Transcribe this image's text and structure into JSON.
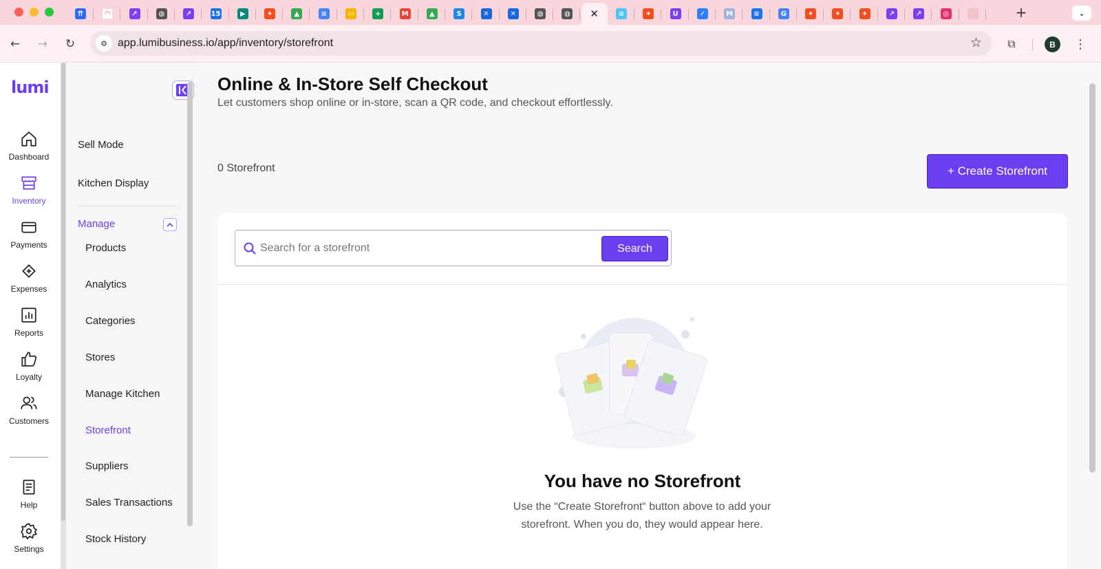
{
  "browser": {
    "tabs": [
      {
        "icon": "jira-icon",
        "color": "#2f6cf6",
        "glyph": "⇈"
      },
      {
        "icon": "monday-icon",
        "color": "#ffffff",
        "glyph": "◠"
      },
      {
        "icon": "clickup-icon",
        "color": "#7b3ff2",
        "glyph": "↗"
      },
      {
        "icon": "globe-icon",
        "color": "#555555",
        "glyph": "◍"
      },
      {
        "icon": "clickup-icon",
        "color": "#7b3ff2",
        "glyph": "↗"
      },
      {
        "icon": "calendar-icon",
        "color": "#1a73e8",
        "glyph": "15"
      },
      {
        "icon": "meet-icon",
        "color": "#00897b",
        "glyph": "▶"
      },
      {
        "icon": "figma-icon",
        "color": "#f24e1e",
        "glyph": "✦"
      },
      {
        "icon": "drive-icon",
        "color": "#34a853",
        "glyph": "▲"
      },
      {
        "icon": "docs-icon",
        "color": "#4285f4",
        "glyph": "≡"
      },
      {
        "icon": "slides-icon",
        "color": "#f4b400",
        "glyph": "▭"
      },
      {
        "icon": "sheets-icon",
        "color": "#0f9d58",
        "glyph": "+"
      },
      {
        "icon": "gmail-icon",
        "color": "#ea4335",
        "glyph": "M"
      },
      {
        "icon": "drive-icon",
        "color": "#34a853",
        "glyph": "▲"
      },
      {
        "icon": "skype-icon",
        "color": "#1e88e5",
        "glyph": "S"
      },
      {
        "icon": "confluence-icon",
        "color": "#1868db",
        "glyph": "✕"
      },
      {
        "icon": "confluence-icon",
        "color": "#1868db",
        "glyph": "✕"
      },
      {
        "icon": "globe-icon",
        "color": "#555555",
        "glyph": "◍"
      },
      {
        "icon": "globe-icon",
        "color": "#555555",
        "glyph": "◍"
      },
      {
        "icon": "close-icon",
        "color": "#222222",
        "glyph": "✕",
        "active": true
      },
      {
        "icon": "docs-icon",
        "color": "#4fc3f7",
        "glyph": "≡"
      },
      {
        "icon": "figma-icon",
        "color": "#f24e1e",
        "glyph": "✦"
      },
      {
        "icon": "upwork-icon",
        "color": "#7b3ff2",
        "glyph": "U"
      },
      {
        "icon": "check-icon",
        "color": "#2d7ff9",
        "glyph": "✓"
      },
      {
        "icon": "miro-icon",
        "color": "#9fb4d8",
        "glyph": "M"
      },
      {
        "icon": "docs-icon",
        "color": "#1a73e8",
        "glyph": "≡"
      },
      {
        "icon": "google-icon",
        "color": "#4285f4",
        "glyph": "G"
      },
      {
        "icon": "figma-icon",
        "color": "#f24e1e",
        "glyph": "✦"
      },
      {
        "icon": "figma-icon",
        "color": "#f24e1e",
        "glyph": "✦"
      },
      {
        "icon": "figma-icon",
        "color": "#f24e1e",
        "glyph": "✦"
      },
      {
        "icon": "clickup-icon",
        "color": "#7b3ff2",
        "glyph": "↗"
      },
      {
        "icon": "clickup-icon",
        "color": "#7b3ff2",
        "glyph": "↗"
      },
      {
        "icon": "instagram-icon",
        "color": "#e1306c",
        "glyph": "◎"
      },
      {
        "icon": "blank-tab-icon",
        "color": "#f3c2cb",
        "glyph": ""
      }
    ],
    "url": "app.lumibusiness.io/app/inventory/storefront",
    "profile_initial": "B"
  },
  "app": {
    "logo": "LUMI",
    "accent": "#6b3ef0",
    "rail": [
      {
        "label": "Dashboard",
        "icon": "home-icon"
      },
      {
        "label": "Inventory",
        "icon": "store-icon",
        "active": true
      },
      {
        "label": "Payments",
        "icon": "card-icon"
      },
      {
        "label": "Expenses",
        "icon": "receipt-icon"
      },
      {
        "label": "Reports",
        "icon": "chart-icon"
      },
      {
        "label": "Loyalty",
        "icon": "thumbs-up-icon"
      },
      {
        "label": "Customers",
        "icon": "users-icon"
      }
    ],
    "rail_bottom": [
      {
        "label": "Help",
        "icon": "help-icon"
      },
      {
        "label": "Settings",
        "icon": "gear-icon"
      }
    ],
    "subnav": {
      "top_items": [
        "Sell Mode",
        "Kitchen Display"
      ],
      "section_label": "Manage",
      "items": [
        "Products",
        "Analytics",
        "Categories",
        "Stores",
        "Manage Kitchen",
        "Storefront",
        "Suppliers",
        "Sales Transactions",
        "Stock History"
      ],
      "active_item": "Storefront"
    },
    "page": {
      "title": "Online & In-Store Self Checkout",
      "subtitle": "Let customers shop online or in-store, scan a QR code, and checkout effortlessly.",
      "count_text": "0 Storefront",
      "create_button": "+ Create Storefront",
      "search_placeholder": "Search for a storefront",
      "search_button": "Search",
      "empty_title": "You have no Storefront",
      "empty_text": "Use the “Create Storefront“ button above to add your storefront. When you do, they would appear here."
    }
  }
}
